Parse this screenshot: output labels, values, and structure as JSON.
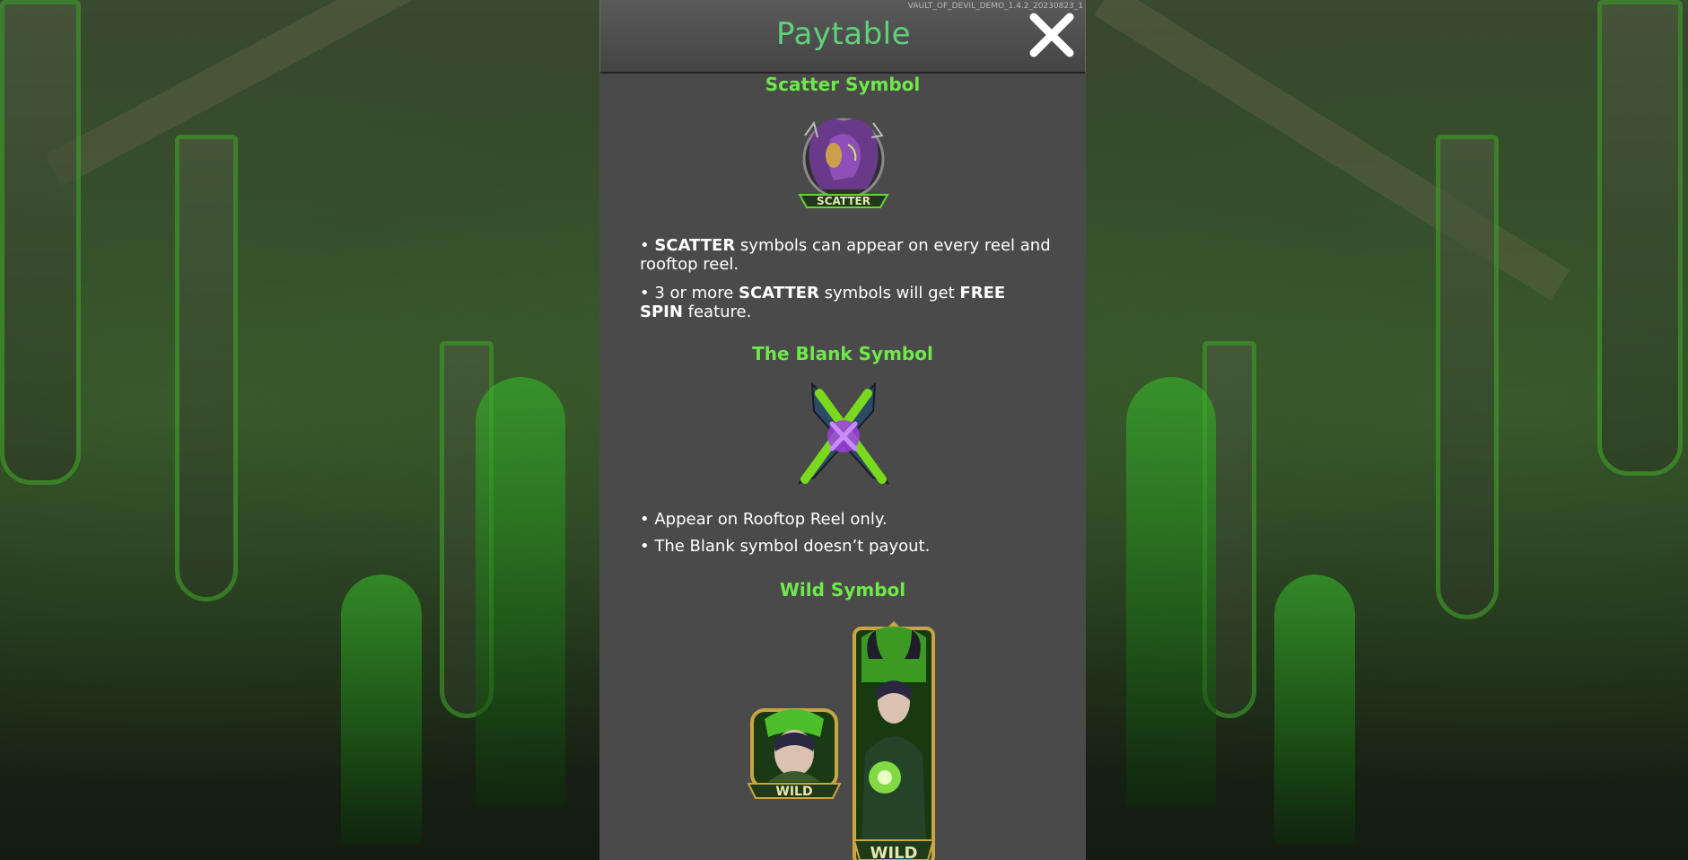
{
  "game": {
    "version": "VAULT_OF_DEVIL_DEMO_1.4.2_20230823_1"
  },
  "paytable": {
    "title": "Paytable",
    "close_label": "close"
  },
  "sections": {
    "scatter": {
      "title": "Scatter Symbol",
      "badge": "SCATTER",
      "bullet1": {
        "prefix": "• ",
        "bold": "SCATTER",
        "rest": " symbols can appear on every reel and rooftop reel."
      },
      "bullet2": {
        "prefix": "• 3 or more ",
        "bold1": "SCATTER",
        "middle": " symbols will get ",
        "bold2": "FREE SPIN",
        "rest": " feature."
      }
    },
    "blank": {
      "title": "The Blank Symbol",
      "bullet1": "• Appear on Rooftop Reel only.",
      "bullet2": "• The Blank symbol doesn’t payout."
    },
    "wild": {
      "title": "Wild Symbol",
      "badge_small": "WILD",
      "badge_tall": "WILD"
    }
  },
  "colors": {
    "title_green": "#5fd27a",
    "section_green": "#6fe84a",
    "panel_bg": "#4a4a4a"
  },
  "icons": [
    "close-icon",
    "scatter-symbol-icon",
    "blank-symbol-icon",
    "wild-symbol-icon",
    "wild-stacked-symbol-icon"
  ]
}
